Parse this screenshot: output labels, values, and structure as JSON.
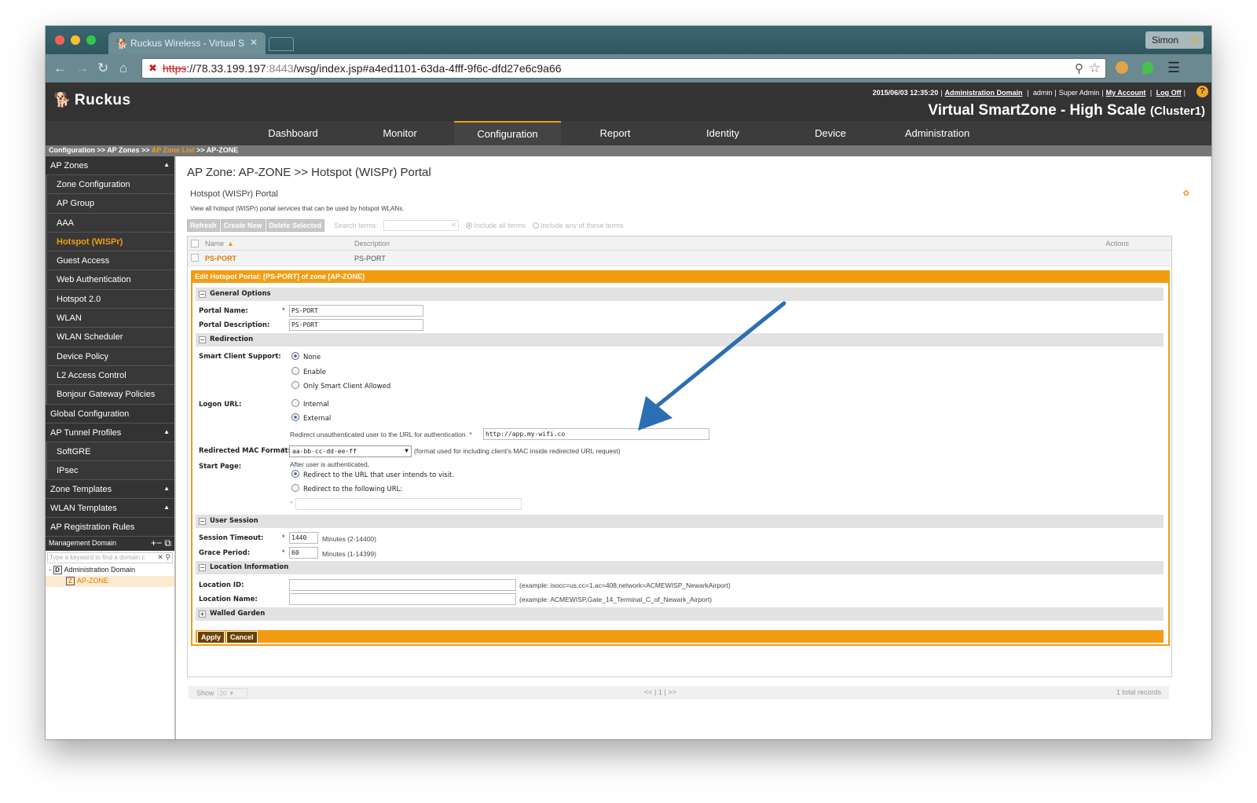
{
  "browser": {
    "tab_title": "Ruckus Wireless - Virtual S",
    "user_button": "Simon",
    "url_scheme": "https",
    "url_host": "://78.33.199.197",
    "url_port": ":8443",
    "url_path": "/wsg/index.jsp#a4ed1101-63da-4fff-9f6c-dfd27e6c9a66"
  },
  "header": {
    "logo_text": "Ruckus",
    "datetime": "2015/06/03 12:35:20",
    "domain_link": "Administration Domain",
    "user": "admin",
    "role": "Super Admin",
    "my_account": "My Account",
    "logoff": "Log Off",
    "product_title": "Virtual SmartZone - High Scale",
    "cluster": "(Cluster1)"
  },
  "nav": {
    "items": [
      "Dashboard",
      "Monitor",
      "Configuration",
      "Report",
      "Identity",
      "Device",
      "Administration"
    ],
    "active": "Configuration"
  },
  "breadcrumb": [
    "Configuration",
    "AP Zones",
    "AP Zone List",
    "AP-ZONE"
  ],
  "sidebar": {
    "ap_zones": "AP Zones",
    "zone_items": [
      "Zone Configuration",
      "AP Group",
      "AAA",
      "Hotspot (WISPr)",
      "Guest Access",
      "Web Authentication",
      "Hotspot 2.0",
      "WLAN",
      "WLAN Scheduler",
      "Device Policy",
      "L2 Access Control",
      "Bonjour Gateway Policies"
    ],
    "active_item": "Hotspot (WISPr)",
    "global_config": "Global Configuration",
    "ap_tunnel_profiles": "AP Tunnel Profiles",
    "tunnel_items": [
      "SoftGRE",
      "IPsec"
    ],
    "zone_templates": "Zone Templates",
    "wlan_templates": "WLAN Templates",
    "ap_registration_rules": "AP Registration Rules",
    "management_domain": "Management Domain",
    "domain_search_placeholder": "Type a keyword to find a domain c",
    "tree_root": "Administration Domain",
    "tree_zone": "AP-ZONE"
  },
  "content": {
    "page_title": "AP Zone: AP-ZONE >> Hotspot (WISPr) Portal",
    "section_title": "Hotspot (WISPr) Portal",
    "section_desc": "View all hotspot (WISPr) portal services that can be used by hotspot WLANs.",
    "buttons": {
      "refresh": "Refresh",
      "create": "Create New",
      "delete": "Delete Selected"
    },
    "search_label": "Search terms:",
    "opt_all": "Include all terms",
    "opt_any": "Include any of these terms",
    "columns": {
      "name": "Name",
      "description": "Description",
      "actions": "Actions"
    },
    "row": {
      "name": "PS-PORT",
      "description": "PS-PORT"
    }
  },
  "edit": {
    "title": "Edit Hotspot Portal: [PS-PORT] of zone [AP-ZONE]",
    "general_options": "General Options",
    "portal_name_label": "Portal Name:",
    "portal_name": "PS-PORT",
    "portal_desc_label": "Portal Description:",
    "portal_desc": "PS-PORT",
    "redirection": "Redirection",
    "smart_client_label": "Smart Client Support:",
    "smart_client_opts": [
      "None",
      "Enable",
      "Only Smart Client Allowed"
    ],
    "logon_url_label": "Logon URL:",
    "logon_opts": [
      "Internal",
      "External"
    ],
    "redirect_hint": "Redirect unauthenticated user to the URL for authentication. *",
    "external_url": "http://app.my-wifi.co",
    "mac_format_label": "Redirected MAC Format:",
    "mac_format": "aa-bb-cc-dd-ee-ff",
    "mac_format_hint": "(format used for including client's MAC inside redirected URL request)",
    "start_page_label": "Start Page:",
    "after_auth": "After user is authenticated,",
    "start_opts": [
      "Redirect to the URL that user intends to visit.",
      "Redirect to the following URL:"
    ],
    "start_url": "",
    "user_session": "User Session",
    "session_timeout_label": "Session Timeout:",
    "session_timeout": "1440",
    "session_timeout_hint": "Minutes (2-14400)",
    "grace_label": "Grace Period:",
    "grace": "60",
    "grace_hint": "Minutes (1-14399)",
    "location_info": "Location Information",
    "location_id_label": "Location ID:",
    "location_id_hint": "(example: isocc=us,cc=1,ac=408,network=ACMEWISP_NewarkAirport)",
    "location_name_label": "Location Name:",
    "location_name_hint": "(example: ACMEWISP,Gate_14_Terminal_C_of_Newark_Airport)",
    "walled_garden": "Walled Garden",
    "apply": "Apply",
    "cancel": "Cancel"
  },
  "pager": {
    "show": "Show",
    "page_size": "20",
    "prev": "<<",
    "page": "1",
    "next": ">>",
    "total": "1 total records"
  },
  "colors": {
    "accent": "#f39c12",
    "arrow": "#2a6fb3"
  }
}
